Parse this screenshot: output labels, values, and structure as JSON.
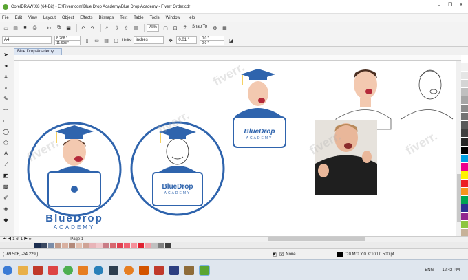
{
  "window": {
    "title": "CorelDRAW X8 (64-Bit) - E:\\Fiverr.com\\Blue Drop Academy\\Blue Drop Academy - Fiverr Order.cdr",
    "controls": [
      "–",
      "❐",
      "✕"
    ]
  },
  "menu": [
    "File",
    "Edit",
    "View",
    "Layout",
    "Object",
    "Effects",
    "Bitmaps",
    "Text",
    "Table",
    "Tools",
    "Window",
    "Help"
  ],
  "toolbar": {
    "zoom": "29%",
    "snap_to": "Snap To",
    "page_size": "A4",
    "width": "8.268 \"",
    "height": "11.693 \"",
    "units_label": "Units:",
    "units_value": "inches",
    "nudge": "0.01 \"",
    "dup_x": "0.0 \"",
    "dup_y": "0.0 \""
  },
  "doc_tab": "Blue Drop Academy ...",
  "page_tab": "Page 1",
  "logos": {
    "brand_top": "BlueDrop",
    "brand_sub": "ACADEMY"
  },
  "status": {
    "coords": "( -69.506, -24.229 )",
    "fill": "None",
    "outline": "C:0 M:0 Y:0 K:100  0.500 pt"
  },
  "taskbar": {
    "lang": "ENG",
    "time": "12:42 PM"
  },
  "colors": {
    "brand_blue": "#2f64ad",
    "skin": "#f3c9b0"
  }
}
